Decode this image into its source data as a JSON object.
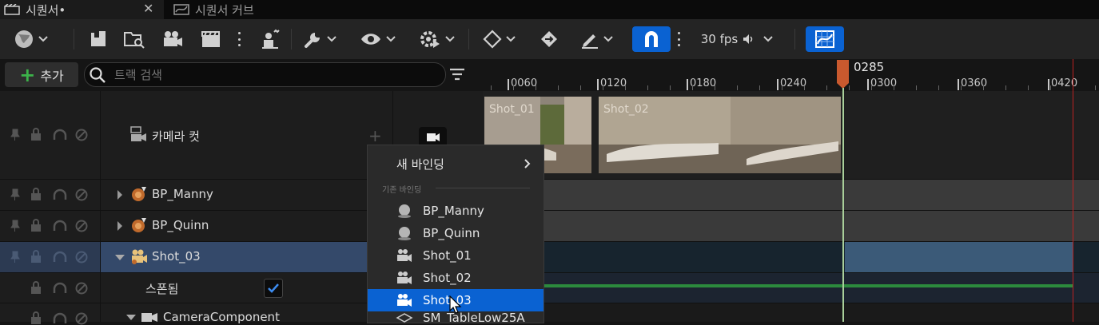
{
  "tabs": [
    {
      "label": "시퀀서•",
      "active": true
    },
    {
      "label": "시퀀서 커브",
      "active": false
    }
  ],
  "toolbar": {
    "fps_label": "30 fps",
    "snap_active": true,
    "curve_editor_active": true,
    "accent_color": "#0a62d2"
  },
  "outliner": {
    "add_label": "추가",
    "search_placeholder": "트랙 검색",
    "rows": [
      {
        "label": "카메라 컷",
        "icon": "camera-cut-icon"
      },
      {
        "label": "BP_Manny",
        "icon": "actor-icon"
      },
      {
        "label": "BP_Quinn",
        "icon": "actor-icon"
      },
      {
        "label": "Shot_03",
        "icon": "camera-actor-icon",
        "selected": true
      },
      {
        "label": "스폰됨",
        "checked": true
      },
      {
        "label": "CameraComponent",
        "icon": "camera-icon"
      }
    ]
  },
  "timeline": {
    "playhead_frame": "0285",
    "ticks": [
      "0060",
      "0120",
      "0180",
      "0240",
      "0300",
      "0360",
      "0420"
    ],
    "camera_cuts": [
      {
        "label": "Shot_01"
      },
      {
        "label": "Shot_02"
      }
    ]
  },
  "menu": {
    "new_binding": "새 바인딩",
    "section": "기존 바인딩",
    "items": [
      {
        "label": "BP_Manny",
        "icon": "sphere-icon"
      },
      {
        "label": "BP_Quinn",
        "icon": "sphere-icon"
      },
      {
        "label": "Shot_01",
        "icon": "camera-actor-icon"
      },
      {
        "label": "Shot_02",
        "icon": "camera-actor-icon"
      },
      {
        "label": "Shot_03",
        "icon": "camera-actor-icon",
        "highlighted": true
      },
      {
        "label": "SM_TableLow25A",
        "icon": "mesh-icon"
      }
    ]
  }
}
